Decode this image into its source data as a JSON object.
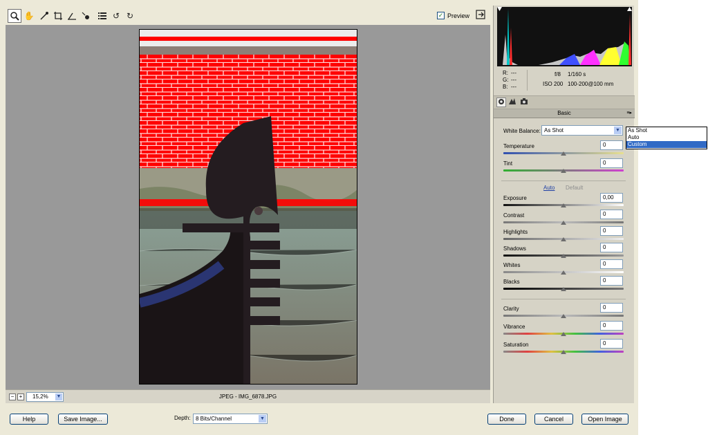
{
  "toolbar": {
    "preview_label": "Preview",
    "preview_checked": true,
    "tools": [
      "zoom-icon",
      "hand-icon",
      "white-balance-eyedropper-icon",
      "crop-icon",
      "straighten-icon",
      "red-eye-icon",
      "preferences-icon",
      "rotate-left-icon",
      "rotate-right-icon"
    ]
  },
  "status": {
    "zoom_out": "−",
    "zoom_in": "+",
    "zoom_value": "15,2%",
    "file_name": "JPEG  -  IMG_6878.JPG"
  },
  "info": {
    "r_label": "R:",
    "r_value": "---",
    "g_label": "G:",
    "g_value": "---",
    "b_label": "B:",
    "b_value": "---",
    "aperture": "f/8",
    "shutter": "1/160 s",
    "iso": "ISO 200",
    "lens": "100-200@100 mm"
  },
  "panel": {
    "section_title": "Basic",
    "white_balance_label": "White Balance:",
    "white_balance_value": "As Shot",
    "white_balance_options": [
      "As Shot",
      "Auto",
      "Custom"
    ],
    "white_balance_highlighted": "Custom",
    "temperature_label": "Temperature",
    "temperature_value": "0",
    "tint_label": "Tint",
    "tint_value": "0",
    "auto_label": "Auto",
    "default_label": "Default",
    "exposure_label": "Exposure",
    "exposure_value": "0,00",
    "contrast_label": "Contrast",
    "contrast_value": "0",
    "highlights_label": "Highlights",
    "highlights_value": "0",
    "shadows_label": "Shadows",
    "shadows_value": "0",
    "whites_label": "Whites",
    "whites_value": "0",
    "blacks_label": "Blacks",
    "blacks_value": "0",
    "clarity_label": "Clarity",
    "clarity_value": "0",
    "vibrance_label": "Vibrance",
    "vibrance_value": "0",
    "saturation_label": "Saturation",
    "saturation_value": "0"
  },
  "footer": {
    "help": "Help",
    "save_image": "Save Image...",
    "depth_label": "Depth:",
    "depth_value": "8 Bits/Channel",
    "done": "Done",
    "cancel": "Cancel",
    "open_image": "Open Image"
  },
  "colors": {
    "clipping_warning": "#ff0000",
    "selection": "#316ac5",
    "link": "#1e3fa5"
  }
}
